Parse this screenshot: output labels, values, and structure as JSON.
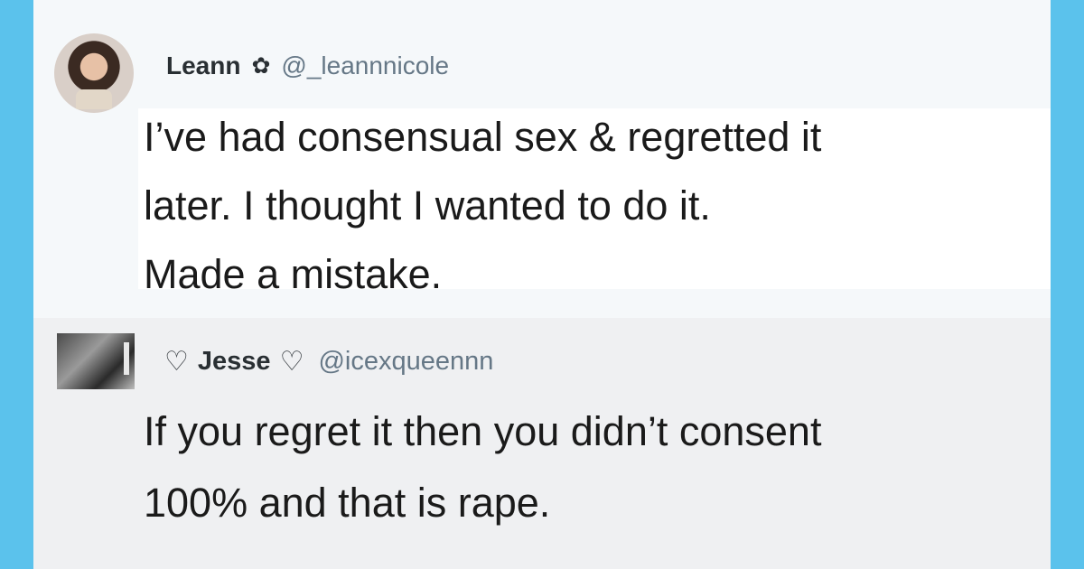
{
  "tweet": {
    "name": "Leann",
    "name_icon": "flower-icon",
    "handle": "@_leannnicole",
    "lines": [
      "I’ve had consensual sex & regretted it",
      "later. I thought I wanted to do it.",
      "Made a mistake."
    ]
  },
  "reply": {
    "name": "Jesse",
    "name_prefix_icon": "heart-outline-icon",
    "name_suffix_icon": "heart-outline-icon",
    "handle": "@icexqueennn",
    "lines": [
      "If you regret it then you didn’t consent",
      "100% and that is rape."
    ]
  },
  "colors": {
    "frame": "#5bc2ec",
    "tweet_bg": "#f5f8fa",
    "reply_bg": "#eff0f2",
    "text": "#1a1a1a",
    "handle": "#657786"
  }
}
